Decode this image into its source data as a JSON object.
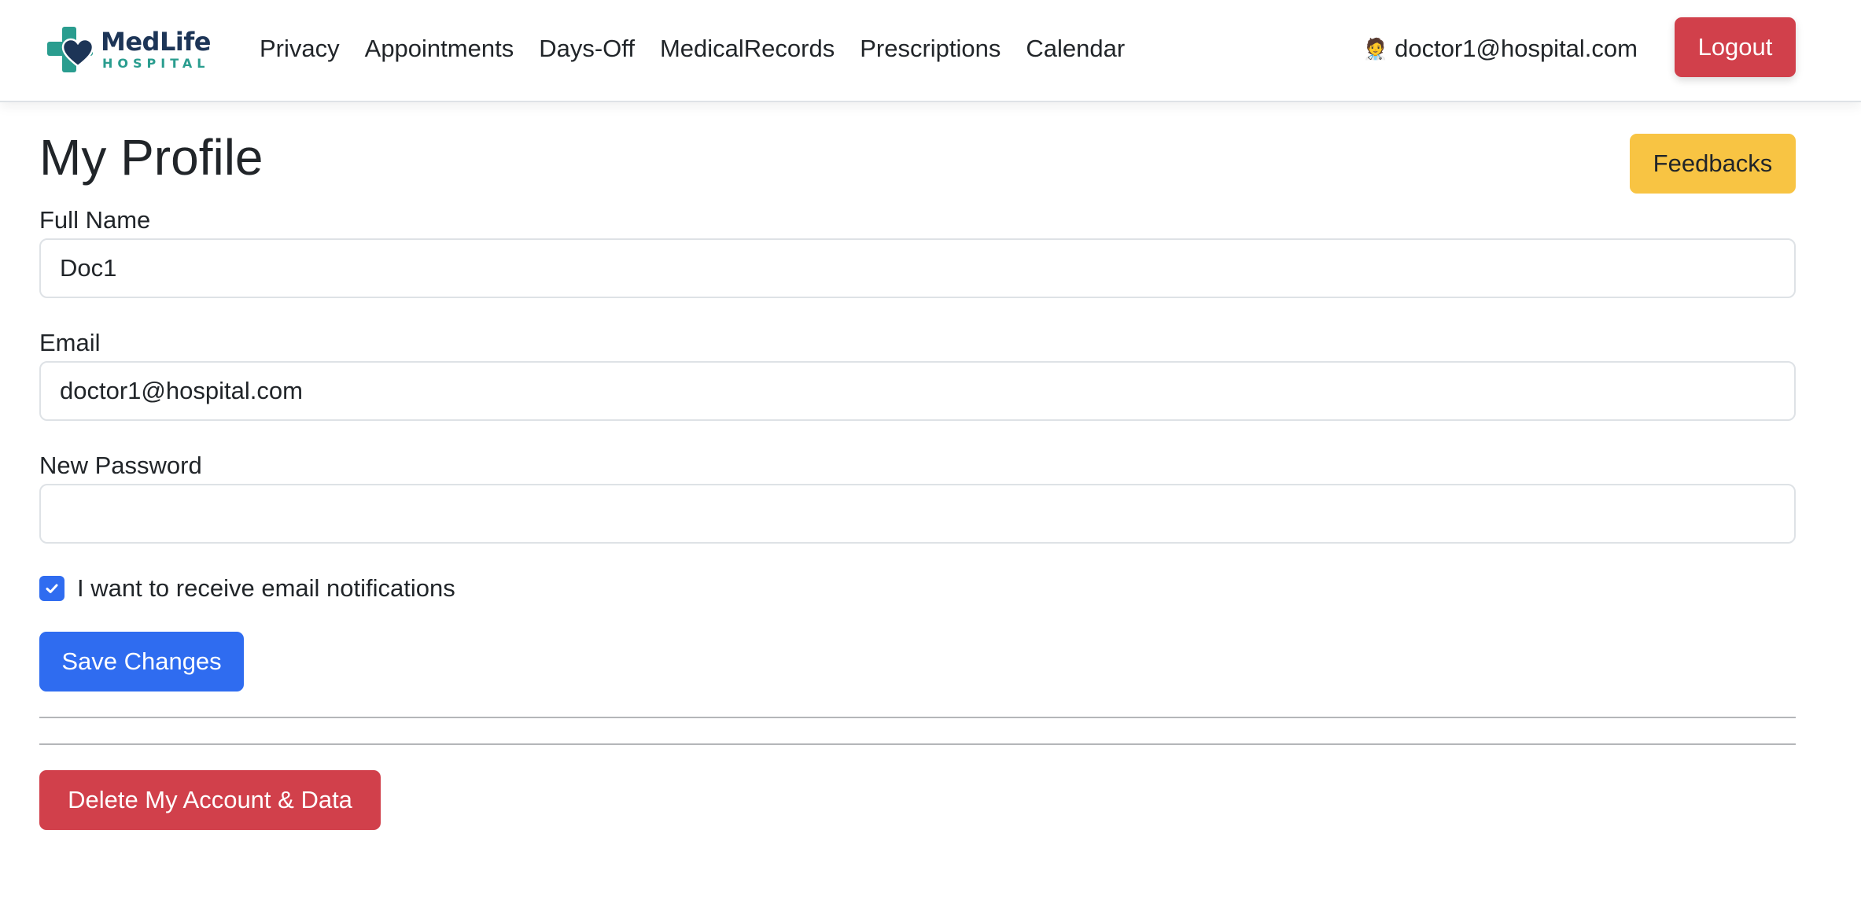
{
  "brand": {
    "name": "MedLife",
    "subtitle": "HOSPITAL",
    "colors": {
      "navy": "#1d3557",
      "teal": "#2a9d8f"
    }
  },
  "nav": {
    "links": [
      "Privacy",
      "Appointments",
      "Days-Off",
      "MedicalRecords",
      "Prescriptions",
      "Calendar"
    ],
    "user_icon": "🧑‍⚕️",
    "user_email": "doctor1@hospital.com",
    "logout_label": "Logout"
  },
  "profile": {
    "title": "My Profile",
    "feedbacks_label": "Feedbacks",
    "full_name_label": "Full Name",
    "full_name_value": "Doc1",
    "email_label": "Email",
    "email_value": "doctor1@hospital.com",
    "new_password_label": "New Password",
    "new_password_value": "",
    "notifications_label": "I want to receive email notifications",
    "notifications_checked": true,
    "save_label": "Save Changes",
    "delete_label": "Delete My Account & Data"
  },
  "colors": {
    "primary": "#2f6cf0",
    "danger": "#d1404b",
    "warning": "#f8c443"
  }
}
